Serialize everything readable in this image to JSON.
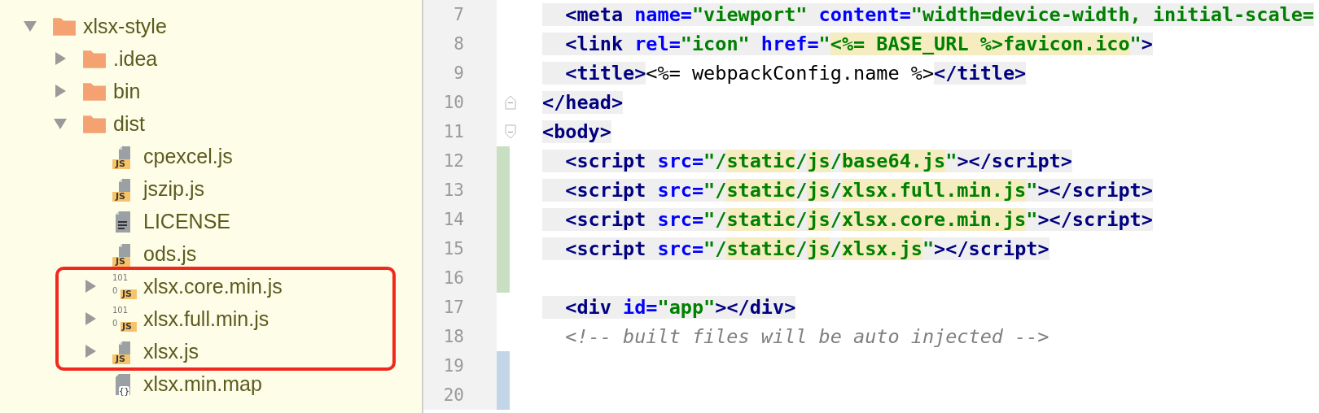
{
  "project_tree": {
    "items": [
      {
        "name": "xlsx-style",
        "kind": "folder",
        "expanded": true,
        "children": [
          {
            "name": ".idea",
            "kind": "folder",
            "expanded": false
          },
          {
            "name": "bin",
            "kind": "folder",
            "expanded": false
          },
          {
            "name": "dist",
            "kind": "folder",
            "expanded": true,
            "children": [
              {
                "name": "cpexcel.js",
                "kind": "js",
                "badge": "JS",
                "outlined": false
              },
              {
                "name": "jszip.js",
                "kind": "js",
                "badge": "JS",
                "outlined": false
              },
              {
                "name": "LICENSE",
                "kind": "text",
                "outlined": false
              },
              {
                "name": "ods.js",
                "kind": "js",
                "badge": "JS",
                "outlined": false
              },
              {
                "name": "xlsx.core.min.js",
                "kind": "binary",
                "badge": "JS",
                "bits": [
                  "101",
                  "0"
                ],
                "expanded": false,
                "outlined": true
              },
              {
                "name": "xlsx.full.min.js",
                "kind": "binary",
                "badge": "JS",
                "bits": [
                  "101",
                  "0"
                ],
                "expanded": false,
                "outlined": true
              },
              {
                "name": "xlsx.js",
                "kind": "js",
                "badge": "JS",
                "expanded": false,
                "outlined": true
              },
              {
                "name": "xlsx.min.map",
                "kind": "json",
                "badge": "{}",
                "outlined": false
              }
            ]
          }
        ]
      }
    ]
  },
  "editor": {
    "lines": [
      {
        "number": "7",
        "kind": "plain",
        "added": false,
        "modified": false,
        "tokens": [
          {
            "t": "  <meta",
            "kind": "tag",
            "shaded": true,
            "marked": false
          },
          {
            "t": " name",
            "kind": "attr",
            "shaded": true,
            "marked": false
          },
          {
            "t": "=",
            "kind": "attr",
            "shaded": true,
            "marked": false
          },
          {
            "t": "\"viewport\"",
            "kind": "str",
            "shaded": true,
            "marked": false
          },
          {
            "t": " content",
            "kind": "attr",
            "shaded": true,
            "marked": false
          },
          {
            "t": "=",
            "kind": "attr",
            "shaded": true,
            "marked": false
          },
          {
            "t": "\"width=device-width, initial-scale=",
            "kind": "str",
            "shaded": true,
            "marked": false
          }
        ]
      },
      {
        "number": "8",
        "kind": "plain",
        "added": false,
        "modified": false,
        "tokens": [
          {
            "t": "  <link",
            "kind": "tag",
            "shaded": true,
            "marked": false
          },
          {
            "t": " rel",
            "kind": "attr",
            "shaded": true,
            "marked": false
          },
          {
            "t": "=",
            "kind": "attr",
            "shaded": true,
            "marked": false
          },
          {
            "t": "\"icon\"",
            "kind": "str",
            "shaded": true,
            "marked": false
          },
          {
            "t": " href",
            "kind": "attr",
            "shaded": true,
            "marked": false
          },
          {
            "t": "=",
            "kind": "attr",
            "shaded": true,
            "marked": false
          },
          {
            "t": "\"",
            "kind": "str",
            "shaded": true,
            "marked": false
          },
          {
            "t": "<%= BASE_URL %>favicon.ico",
            "kind": "str",
            "shaded": false,
            "marked": true
          },
          {
            "t": "\"",
            "kind": "str",
            "shaded": true,
            "marked": false
          },
          {
            "t": ">",
            "kind": "tag",
            "shaded": true,
            "marked": false
          }
        ]
      },
      {
        "number": "9",
        "kind": "plain",
        "added": false,
        "modified": false,
        "tokens": [
          {
            "t": "  <title>",
            "kind": "tag",
            "shaded": true,
            "marked": false
          },
          {
            "t": "<%= webpackConfig.name %>",
            "kind": "text",
            "shaded": false,
            "marked": false
          },
          {
            "t": "</title>",
            "kind": "tag",
            "shaded": true,
            "marked": false
          }
        ]
      },
      {
        "number": "10",
        "kind": "fold_end",
        "added": false,
        "modified": false,
        "tokens": [
          {
            "t": "</head>",
            "kind": "tag",
            "shaded": true,
            "marked": false
          }
        ]
      },
      {
        "number": "11",
        "kind": "fold_start",
        "added": false,
        "modified": false,
        "tokens": [
          {
            "t": "<body>",
            "kind": "tag",
            "shaded": true,
            "marked": false
          }
        ]
      },
      {
        "number": "12",
        "kind": "plain",
        "added": true,
        "modified": false,
        "tokens": [
          {
            "t": "  <script",
            "kind": "tag",
            "shaded": true,
            "marked": false
          },
          {
            "t": " src",
            "kind": "attr",
            "shaded": true,
            "marked": false
          },
          {
            "t": "=",
            "kind": "attr",
            "shaded": true,
            "marked": false
          },
          {
            "t": "\"/",
            "kind": "str",
            "shaded": true,
            "marked": false
          },
          {
            "t": "static",
            "kind": "str",
            "shaded": false,
            "marked": true
          },
          {
            "t": "/",
            "kind": "str",
            "shaded": true,
            "marked": false
          },
          {
            "t": "js",
            "kind": "str",
            "shaded": false,
            "marked": true
          },
          {
            "t": "/",
            "kind": "str",
            "shaded": true,
            "marked": false
          },
          {
            "t": "base64.js",
            "kind": "str",
            "shaded": false,
            "marked": true
          },
          {
            "t": "\"",
            "kind": "str",
            "shaded": true,
            "marked": false
          },
          {
            "t": "></script>",
            "kind": "tag",
            "shaded": true,
            "marked": false
          }
        ]
      },
      {
        "number": "13",
        "kind": "plain",
        "added": true,
        "modified": false,
        "tokens": [
          {
            "t": "  <script",
            "kind": "tag",
            "shaded": true,
            "marked": false
          },
          {
            "t": " src",
            "kind": "attr",
            "shaded": true,
            "marked": false
          },
          {
            "t": "=",
            "kind": "attr",
            "shaded": true,
            "marked": false
          },
          {
            "t": "\"/",
            "kind": "str",
            "shaded": true,
            "marked": false
          },
          {
            "t": "static",
            "kind": "str",
            "shaded": false,
            "marked": true
          },
          {
            "t": "/",
            "kind": "str",
            "shaded": true,
            "marked": false
          },
          {
            "t": "js",
            "kind": "str",
            "shaded": false,
            "marked": true
          },
          {
            "t": "/",
            "kind": "str",
            "shaded": true,
            "marked": false
          },
          {
            "t": "xlsx.full.min.js",
            "kind": "str",
            "shaded": false,
            "marked": true
          },
          {
            "t": "\"",
            "kind": "str",
            "shaded": true,
            "marked": false
          },
          {
            "t": "></script>",
            "kind": "tag",
            "shaded": true,
            "marked": false
          }
        ]
      },
      {
        "number": "14",
        "kind": "plain",
        "added": true,
        "modified": false,
        "tokens": [
          {
            "t": "  <script",
            "kind": "tag",
            "shaded": true,
            "marked": false
          },
          {
            "t": " src",
            "kind": "attr",
            "shaded": true,
            "marked": false
          },
          {
            "t": "=",
            "kind": "attr",
            "shaded": true,
            "marked": false
          },
          {
            "t": "\"/",
            "kind": "str",
            "shaded": true,
            "marked": false
          },
          {
            "t": "static",
            "kind": "str",
            "shaded": false,
            "marked": true
          },
          {
            "t": "/",
            "kind": "str",
            "shaded": true,
            "marked": false
          },
          {
            "t": "js",
            "kind": "str",
            "shaded": false,
            "marked": true
          },
          {
            "t": "/",
            "kind": "str",
            "shaded": true,
            "marked": false
          },
          {
            "t": "xlsx.core.min.js",
            "kind": "str",
            "shaded": false,
            "marked": true
          },
          {
            "t": "\"",
            "kind": "str",
            "shaded": true,
            "marked": false
          },
          {
            "t": "></script>",
            "kind": "tag",
            "shaded": true,
            "marked": false
          }
        ]
      },
      {
        "number": "15",
        "kind": "plain",
        "added": true,
        "modified": false,
        "tokens": [
          {
            "t": "  <script",
            "kind": "tag",
            "shaded": true,
            "marked": false
          },
          {
            "t": " src",
            "kind": "attr",
            "shaded": true,
            "marked": false
          },
          {
            "t": "=",
            "kind": "attr",
            "shaded": true,
            "marked": false
          },
          {
            "t": "\"/",
            "kind": "str",
            "shaded": true,
            "marked": false
          },
          {
            "t": "static",
            "kind": "str",
            "shaded": false,
            "marked": true
          },
          {
            "t": "/",
            "kind": "str",
            "shaded": true,
            "marked": false
          },
          {
            "t": "js",
            "kind": "str",
            "shaded": false,
            "marked": true
          },
          {
            "t": "/",
            "kind": "str",
            "shaded": true,
            "marked": false
          },
          {
            "t": "xlsx.js",
            "kind": "str",
            "shaded": false,
            "marked": true
          },
          {
            "t": "\"",
            "kind": "str",
            "shaded": true,
            "marked": false
          },
          {
            "t": "></script>",
            "kind": "tag",
            "shaded": true,
            "marked": false
          }
        ]
      },
      {
        "number": "16",
        "kind": "plain",
        "added": true,
        "modified": false
      },
      {
        "number": "17",
        "kind": "plain",
        "added": false,
        "modified": false,
        "tokens": [
          {
            "t": "  <div",
            "kind": "tag",
            "shaded": true,
            "marked": false
          },
          {
            "t": " id",
            "kind": "attr",
            "shaded": true,
            "marked": false
          },
          {
            "t": "=",
            "kind": "attr",
            "shaded": true,
            "marked": false
          },
          {
            "t": "\"app\"",
            "kind": "str",
            "shaded": true,
            "marked": false
          },
          {
            "t": "></div>",
            "kind": "tag",
            "shaded": true,
            "marked": false
          }
        ]
      },
      {
        "number": "18",
        "kind": "plain",
        "added": false,
        "modified": false,
        "tokens": [
          {
            "t": "  <!-- built files will be auto injected -->",
            "kind": "comment",
            "shaded": false,
            "marked": false
          }
        ]
      },
      {
        "number": "19",
        "kind": "plain",
        "added": false,
        "modified": true
      },
      {
        "number": "20",
        "kind": "plain",
        "added": false,
        "modified": true
      }
    ]
  }
}
